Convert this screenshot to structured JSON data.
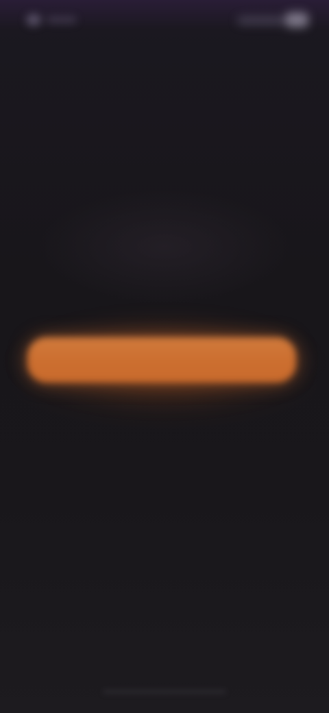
{
  "status_bar": {
    "time": "",
    "indicators": [
      "signal-icon",
      "wifi-icon",
      "battery-icon"
    ]
  },
  "cta": {
    "label": "",
    "color": "#cc6f30"
  },
  "colors": {
    "background": "#18161a",
    "status_tint": "#2c1e3a",
    "accent": "#cc6f30"
  }
}
